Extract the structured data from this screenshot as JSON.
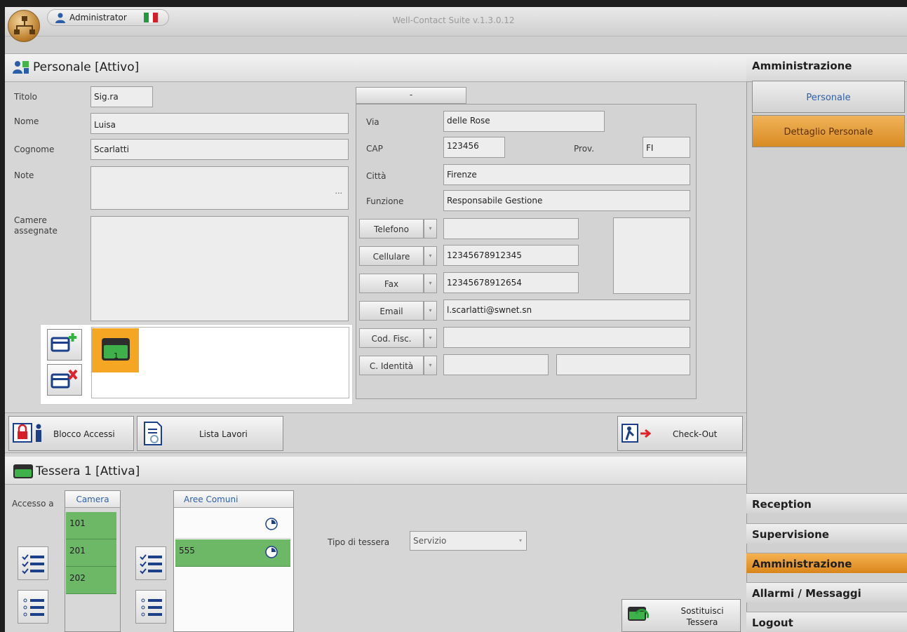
{
  "app": {
    "title": "Well-Contact Suite v.1.3.0.12",
    "user": "Administrator"
  },
  "personale": {
    "header": "Personale [Attivo]",
    "labels": {
      "titolo": "Titolo",
      "nome": "Nome",
      "cognome": "Cognome",
      "note": "Note",
      "camere_line1": "Camere",
      "camere_line2": "assegnate"
    },
    "values": {
      "titolo": "Sig.ra",
      "nome": "Luisa",
      "cognome": "Scarlatti",
      "note": "",
      "note_more": "..."
    }
  },
  "address": {
    "tab_label": "-",
    "labels": {
      "via": "Via",
      "cap": "CAP",
      "prov": "Prov.",
      "citta": "Città",
      "funzione": "Funzione"
    },
    "values": {
      "via": "delle Rose",
      "cap": "123456",
      "prov": "FI",
      "citta": "Firenze",
      "funzione": "Responsabile Gestione"
    }
  },
  "contacts": [
    {
      "label": "Telefono",
      "value": ""
    },
    {
      "label": "Cellulare",
      "value": "12345678912345"
    },
    {
      "label": "Fax",
      "value": "12345678912654"
    },
    {
      "label": "Email",
      "value": "l.scarlatti@swnet.sn"
    },
    {
      "label": "Cod. Fisc.",
      "value": ""
    },
    {
      "label": "C. Identità",
      "value": "",
      "value2": ""
    }
  ],
  "card_list": {
    "card_number": "1"
  },
  "actions": {
    "blocco_accessi": "Blocco Accessi",
    "lista_lavori": "Lista Lavori",
    "check_out": "Check-Out"
  },
  "tessera": {
    "header": "Tessera 1 [Attiva]",
    "accesso_label": "Accesso a",
    "camera_header": "Camera",
    "rooms": [
      "101",
      "201",
      "202"
    ],
    "aree_header": "Aree Comuni",
    "areas": [
      "",
      "555"
    ],
    "tipo_label": "Tipo di tessera",
    "tipo_value": "Servizio",
    "sostituisci_line1": "Sostituisci",
    "sostituisci_line2": "Tessera"
  },
  "sidebar": {
    "header": "Amministrazione",
    "buttons": [
      "Personale",
      "Dettaglio Personale"
    ],
    "nav": [
      "Reception",
      "Supervisione",
      "Amministrazione",
      "Allarmi / Messaggi",
      "Logout"
    ]
  },
  "colors": {
    "accent_orange": "#e8a13a",
    "active_green": "#6cb867",
    "highlight_orange": "#f5a623"
  }
}
